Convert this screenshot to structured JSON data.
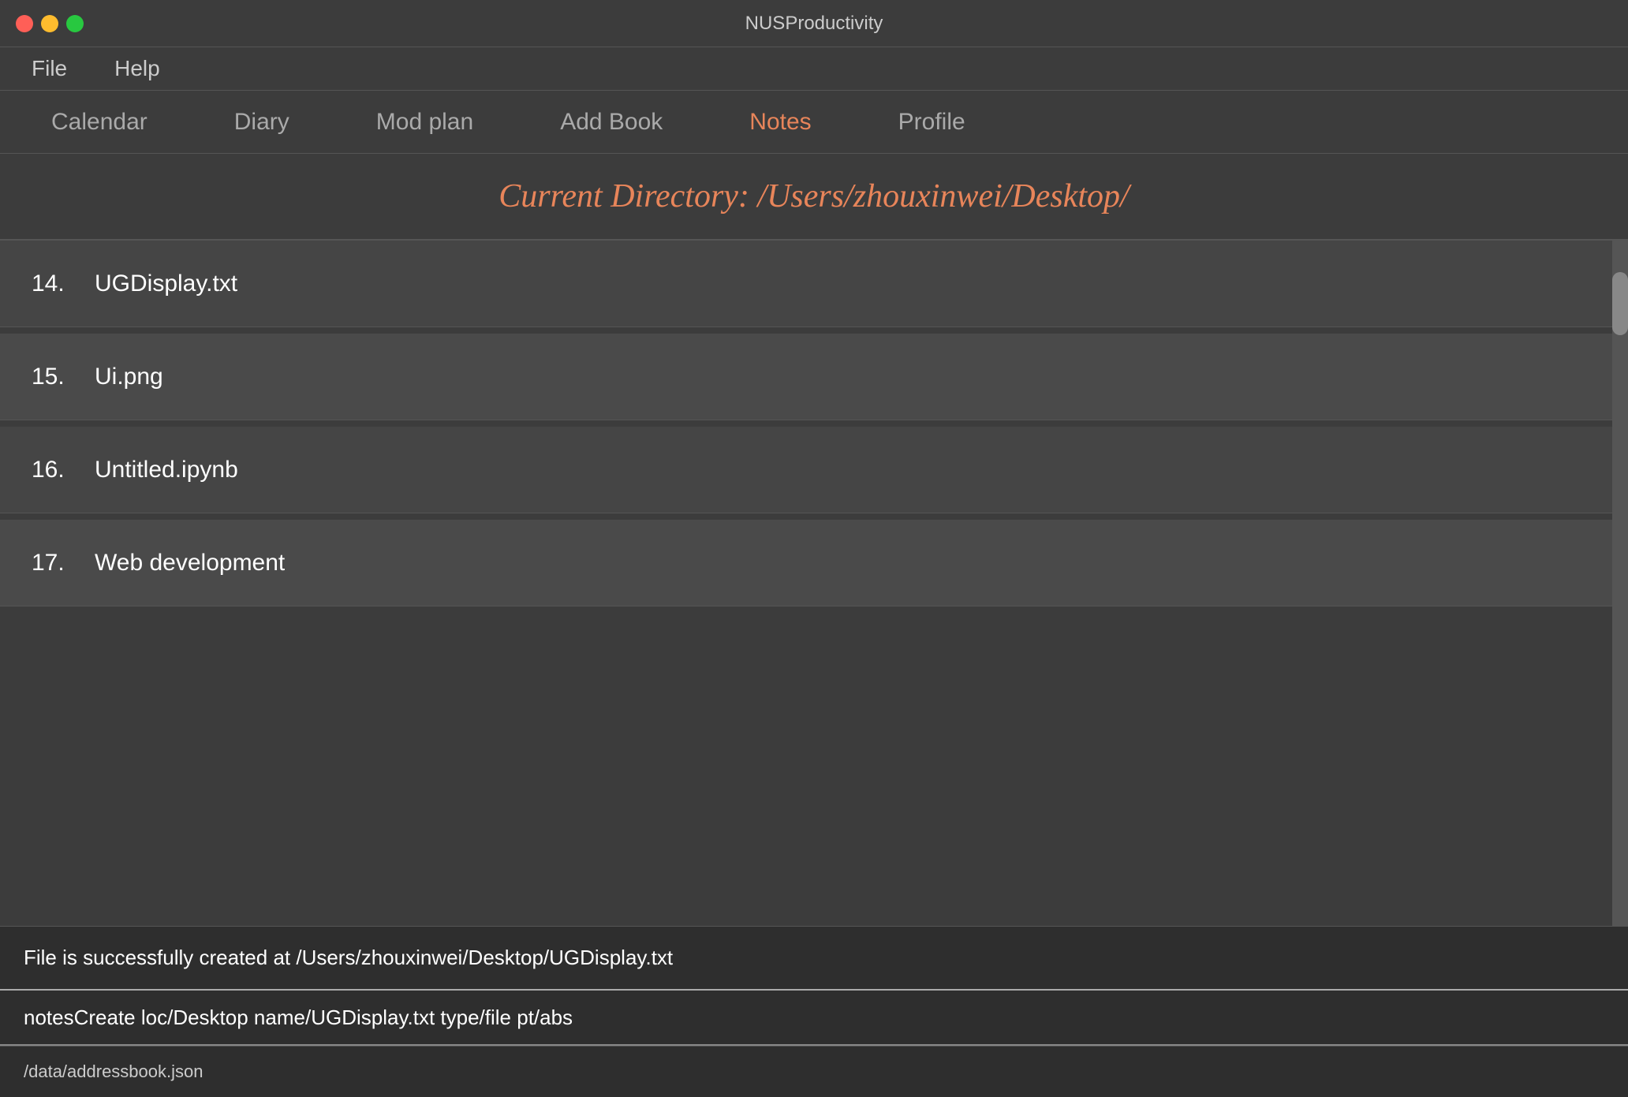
{
  "window": {
    "title": "NUSProductivity"
  },
  "controls": {
    "close": "close",
    "minimize": "minimize",
    "maximize": "maximize"
  },
  "menu": {
    "items": [
      {
        "label": "File"
      },
      {
        "label": "Help"
      }
    ]
  },
  "nav": {
    "items": [
      {
        "label": "Calendar",
        "active": false
      },
      {
        "label": "Diary",
        "active": false
      },
      {
        "label": "Mod plan",
        "active": false
      },
      {
        "label": "Add Book",
        "active": false
      },
      {
        "label": "Notes",
        "active": true
      },
      {
        "label": "Profile",
        "active": false
      }
    ]
  },
  "directory": {
    "label": "Current Directory: /Users/zhouxinwei/Desktop/"
  },
  "files": [
    {
      "number": "14.",
      "name": "UGDisplay.txt"
    },
    {
      "number": "15.",
      "name": "Ui.png"
    },
    {
      "number": "16.",
      "name": "Untitled.ipynb"
    },
    {
      "number": "17.",
      "name": "Web development"
    }
  ],
  "status": {
    "message": "File is successfully created at /Users/zhouxinwei/Desktop/UGDisplay.txt"
  },
  "command": {
    "text": "notesCreate loc/Desktop name/UGDisplay.txt type/file pt/abs"
  },
  "footer": {
    "text": "/data/addressbook.json"
  }
}
